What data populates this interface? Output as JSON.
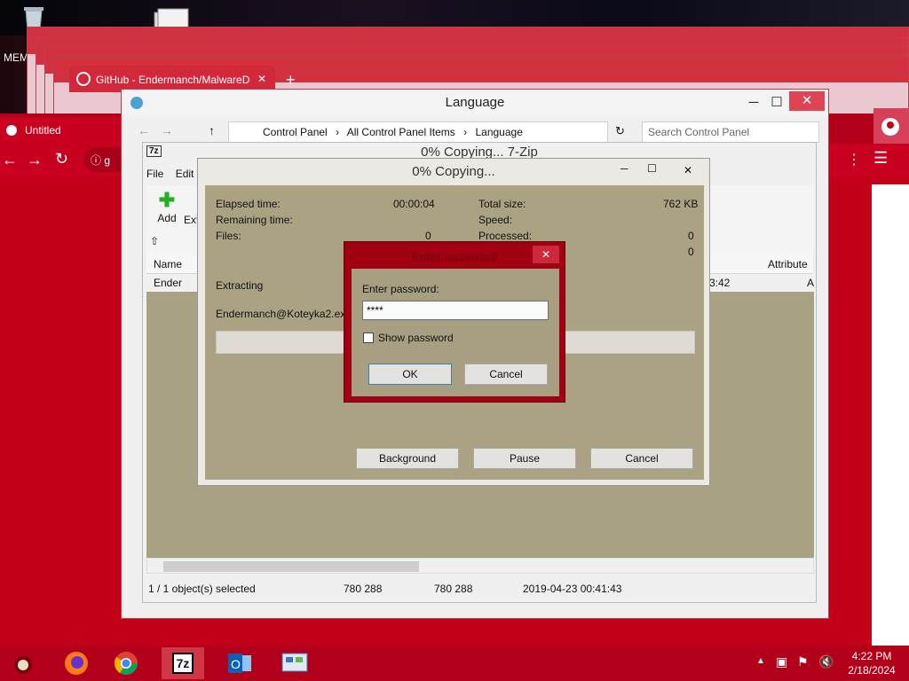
{
  "desktop": {
    "mem_label": "MEM"
  },
  "github_tab": {
    "title": "GitHub - Endermanch/MalwareD"
  },
  "chrome": {
    "tab_title": "Untitled",
    "url_partial": "g"
  },
  "control_panel": {
    "title": "Language",
    "breadcrumbs": [
      "Control Panel",
      "All Control Panel Items",
      "Language"
    ],
    "search_placeholder": "Search Control Panel"
  },
  "sevenzip": {
    "title": "0% Copying... 7-Zip",
    "menu": [
      "File",
      "Edit"
    ],
    "toolbar": {
      "add_label": "Add",
      "extract_label": "Ext"
    },
    "columns": [
      "Name",
      "Attribute"
    ],
    "row": {
      "name": "Ender",
      "time_partial": "3:42",
      "attr_partial": "A"
    },
    "status": {
      "selected": "1 / 1 object(s) selected",
      "size": "780 288",
      "packed": "780 288",
      "modified": "2019-04-23 00:41:43"
    }
  },
  "copy_dialog": {
    "title": "0% Copying...",
    "elapsed_label": "Elapsed time:",
    "elapsed_value": "00:00:04",
    "remaining_label": "Remaining time:",
    "files_label": "Files:",
    "files_value": "0",
    "total_label": "Total size:",
    "total_value": "762 KB",
    "speed_label": "Speed:",
    "processed_label": "Processed:",
    "processed_value": "0",
    "extra_value": "0",
    "action": "Extracting",
    "filename": "Endermanch@Koteyka2.exe",
    "progress": 0,
    "buttons": {
      "background": "Background",
      "pause": "Pause",
      "cancel": "Cancel"
    }
  },
  "password_dialog": {
    "title": "Enter password",
    "prompt": "Enter password:",
    "value": "****",
    "show_password_label": "Show password",
    "ok": "OK",
    "cancel": "Cancel"
  },
  "taskbar": {
    "time": "4:22 PM",
    "date": "2/18/2024",
    "apps": [
      "firefox-icon",
      "chrome-icon",
      "7zip-icon",
      "outlook-icon",
      "control-panel-icon"
    ]
  },
  "colors": {
    "accent": "#b3001a",
    "dialog_bg": "#a9a184"
  }
}
